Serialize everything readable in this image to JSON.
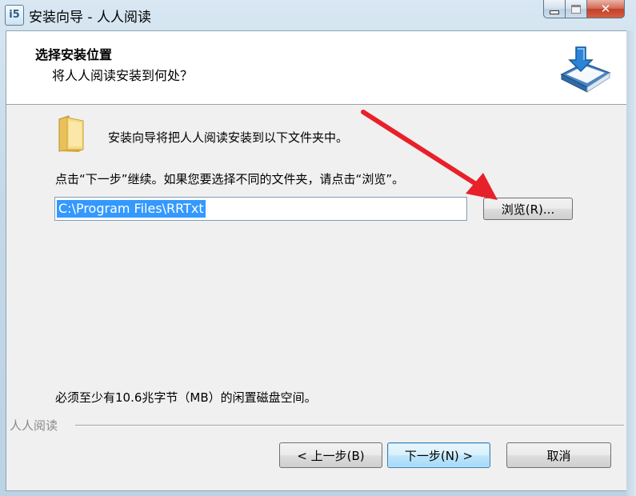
{
  "window": {
    "title": "安装向导 - 人人阅读",
    "app_icon_glyph": "i5",
    "close_glyph": "✕"
  },
  "header": {
    "title": "选择安装位置",
    "subtitle": "将人人阅读安装到何处？"
  },
  "content": {
    "intro": "安装向导将把人人阅读安装到以下文件夹中。",
    "hint": "点击“下一步”继续。如果您要选择不同的文件夹，请点击“浏览”。",
    "install_path": "C:\\Program Files\\RRTxt",
    "browse_label": "浏览(R)...",
    "disk_space": "必须至少有10.6兆字节（MB）的闲置磁盘空间。"
  },
  "footer": {
    "brand": "人人阅读",
    "back_label": "< 上一步(B)",
    "next_label": "下一步(N) >",
    "cancel_label": "取消"
  },
  "icons": {
    "folder": "folder-icon",
    "book": "book-download-icon",
    "annotation": "red-arrow"
  },
  "colors": {
    "selection": "#3399ff",
    "annotation_arrow": "#e8202a",
    "header_bg": "#ffffff",
    "dialog_bg": "#f0f0f0"
  }
}
